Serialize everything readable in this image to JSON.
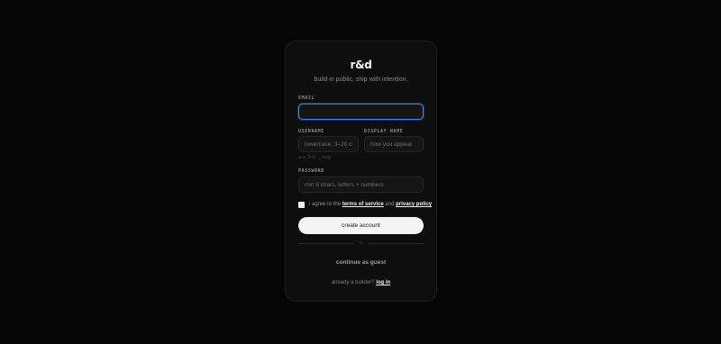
{
  "brand": {
    "logo": "r&d",
    "tagline": "build in public, ship with intention."
  },
  "form": {
    "email": {
      "label": "EMAIL",
      "value": "",
      "placeholder": ""
    },
    "username": {
      "label": "USERNAME",
      "placeholder": "lowercase, 3–20 ch",
      "hint": "a-z, 0-9, _ only"
    },
    "display_name": {
      "label": "DISPLAY NAME",
      "placeholder": "how you appear"
    },
    "password": {
      "label": "PASSWORD",
      "placeholder": "min 8 chars, letters + numbers"
    },
    "terms": {
      "checked": false,
      "prefix": "i agree to the",
      "terms_link": "terms of service",
      "joiner": "and",
      "privacy_link": "privacy policy"
    },
    "submit_label": "create account",
    "divider_label": "or",
    "guest_label": "continue as guest"
  },
  "footer": {
    "prompt": "already a builder?",
    "login_link": "log in"
  },
  "colors": {
    "background": "#050505",
    "card": "#0e0e0e",
    "focus_ring": "#3b82f6",
    "primary_button": "#f4f4f4"
  }
}
